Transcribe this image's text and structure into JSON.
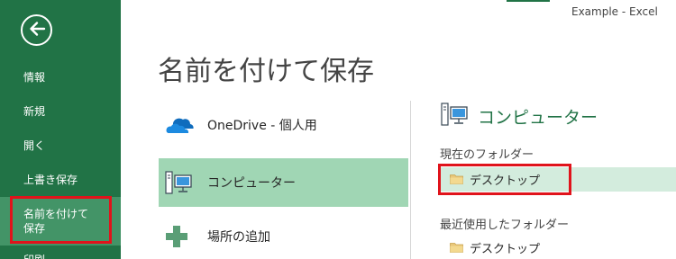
{
  "window": {
    "title": "Example - Excel"
  },
  "sidebar": {
    "back_icon": "back-arrow-icon",
    "items": [
      {
        "label": "情報"
      },
      {
        "label": "新規"
      },
      {
        "label": "開く"
      },
      {
        "label": "上書き保存"
      },
      {
        "label_line1": "名前を付けて",
        "label_line2": "保存",
        "active": true
      },
      {
        "label": "印刷"
      }
    ]
  },
  "main": {
    "page_title": "名前を付けて保存",
    "places": [
      {
        "label": "OneDrive - 個人用",
        "icon": "onedrive-cloud-icon"
      },
      {
        "label": "コンピューター",
        "icon": "computer-icon",
        "selected": true
      },
      {
        "label": "場所の追加",
        "icon": "plus-icon"
      }
    ],
    "right_panel": {
      "header": "コンピューター",
      "header_icon": "computer-icon",
      "current_folder_label": "現在のフォルダー",
      "current_folder": "デスクトップ",
      "recent_folders_label": "最近使用したフォルダー",
      "recent_folders": [
        "デスクトップ"
      ]
    }
  },
  "colors": {
    "brand_green": "#217346",
    "nav_active": "#439467",
    "place_selected": "#a0d6b4",
    "folder_selected": "#d3ecdd",
    "highlight_red": "#e0131b"
  }
}
